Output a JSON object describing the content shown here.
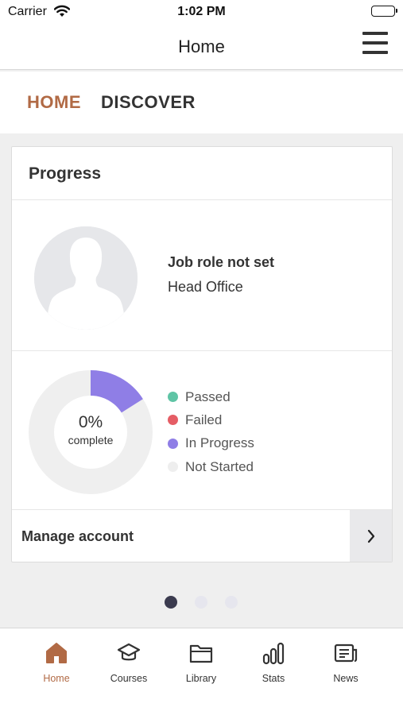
{
  "status_bar": {
    "carrier": "Carrier",
    "time": "1:02 PM"
  },
  "nav": {
    "title": "Home"
  },
  "top_tabs": [
    {
      "label": "HOME",
      "active": true
    },
    {
      "label": "DISCOVER",
      "active": false
    }
  ],
  "progress_card": {
    "title": "Progress",
    "profile": {
      "job_role": "Job role not set",
      "office": "Head Office"
    },
    "completion": {
      "percent_text": "0%",
      "label": "complete",
      "in_progress_fraction": 0.16
    },
    "legend": [
      {
        "label": "Passed",
        "color": "#5fc4a5"
      },
      {
        "label": "Failed",
        "color": "#e55d65"
      },
      {
        "label": "In Progress",
        "color": "#8f7ee6"
      },
      {
        "label": "Not Started",
        "color": "#eeeeee"
      }
    ],
    "manage_account": {
      "label": "Manage account"
    }
  },
  "pager": {
    "count": 3,
    "active_index": 0
  },
  "bottom_tabs": [
    {
      "label": "Home",
      "icon": "home-icon",
      "active": true
    },
    {
      "label": "Courses",
      "icon": "graduation-cap-icon",
      "active": false
    },
    {
      "label": "Library",
      "icon": "folder-icon",
      "active": false
    },
    {
      "label": "Stats",
      "icon": "bar-chart-icon",
      "active": false
    },
    {
      "label": "News",
      "icon": "newspaper-icon",
      "active": false
    }
  ],
  "colors": {
    "accent": "#b16a45",
    "text": "#333333",
    "background": "#efefef"
  }
}
